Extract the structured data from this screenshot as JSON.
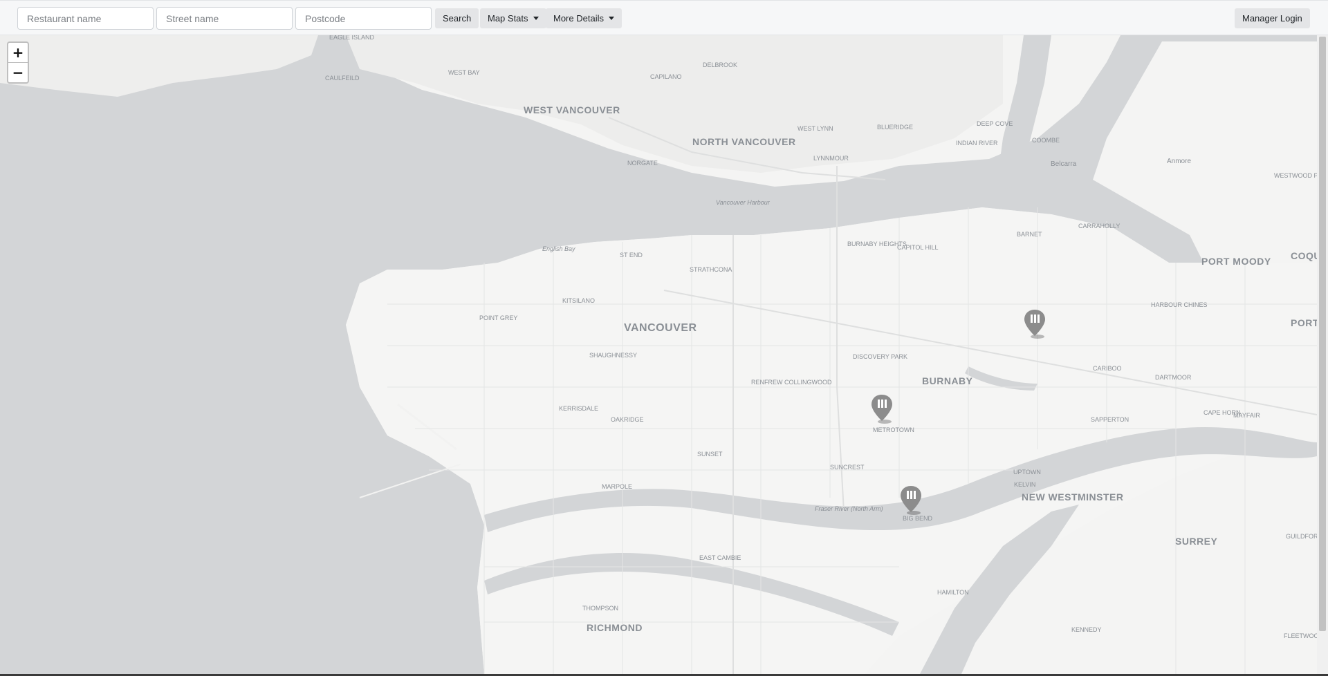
{
  "search": {
    "restaurant_placeholder": "Restaurant name",
    "street_placeholder": "Street name",
    "postcode_placeholder": "Postcode",
    "search_label": "Search"
  },
  "menus": {
    "map_stats_label": "Map Stats",
    "more_details_label": "More Details"
  },
  "auth": {
    "manager_login_label": "Manager Login"
  },
  "zoom": {
    "in_label": "+",
    "out_label": "−"
  },
  "map": {
    "labels_major": [
      "WEST VANCOUVER",
      "NORTH VANCOUVER",
      "VANCOUVER",
      "BURNABY",
      "NEW WESTMINSTER",
      "RICHMOND",
      "SURREY",
      "PORT MOODY",
      "COQUIT",
      "PORT"
    ],
    "labels_minor": [
      "EAGLE ISLAND",
      "CAULFEILD",
      "WEST BAY",
      "DELBROOK",
      "CAPILANO",
      "WEST LYNN",
      "BLUERIDGE",
      "DEEP COVE",
      "INDIAN RIVER",
      "COOMBE",
      "Belcarra",
      "Anmore",
      "WESTWOOD PLATEAU",
      "NORGATE",
      "LYNNMOUR",
      "Vancouver Harbour",
      "English Bay",
      "ST END",
      "STRATHCONA",
      "BURNABY HEIGHTS",
      "CAPITOL HILL",
      "BARNET",
      "CARRAHOLLY",
      "KITSILANO",
      "POINT GREY",
      "SHAUGHNESSY",
      "DISCOVERY PARK",
      "RENFREW COLLINGWOOD",
      "HARBOUR CHINES",
      "CARIBOO",
      "DARTMOOR",
      "KERRISDALE",
      "OAKRIDGE",
      "METROTOWN",
      "SAPPERTON",
      "CAPE HORN",
      "MAYFAIR",
      "SUNSET",
      "SUNCREST",
      "UPTOWN",
      "KELVIN",
      "MARPOLE",
      "Fraser River (North Arm)",
      "BIG BEND",
      "GUILDFORD",
      "EAST CAMBIE",
      "HAMILTON",
      "THOMPSON",
      "KENNEDY",
      "FLEETWOOD"
    ]
  },
  "markers": [
    {
      "name": "restaurant-marker-burnaby-north"
    },
    {
      "name": "restaurant-marker-metrotown"
    },
    {
      "name": "restaurant-marker-big-bend"
    }
  ],
  "colors": {
    "water": "#d3d5d7",
    "land": "#f4f4f3",
    "road": "#e2e3e3",
    "marker": "#8c8c8c"
  }
}
